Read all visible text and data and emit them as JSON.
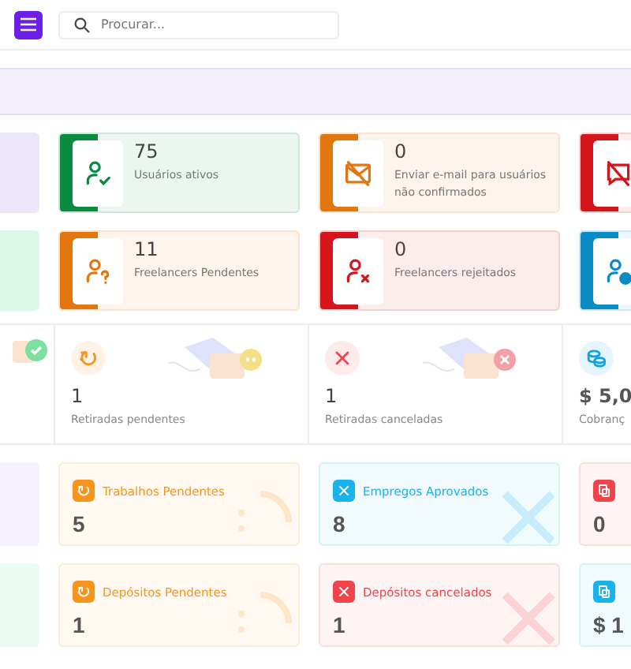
{
  "header": {
    "search": {
      "placeholder": "Procurar..."
    }
  },
  "stat_rows": [
    [
      {
        "color": "#ece6fb"
      },
      {
        "color": "#0b8a41",
        "kind": "user-check",
        "value": "75",
        "label": "Usuários ativos"
      },
      {
        "color": "#e2760f",
        "kind": "mail-off",
        "value": "0",
        "label": "Enviar e-mail para usuários não confirmados"
      },
      {
        "color": "#d4151b",
        "kind": "chat-off"
      }
    ],
    [
      {
        "color": "#dcf8e8"
      },
      {
        "color": "#e2760f",
        "kind": "user-question",
        "value": "11",
        "label": "Freelancers Pendentes"
      },
      {
        "color": "#d4151b",
        "kind": "user-x",
        "value": "0",
        "label": "Freelancers rejeitados"
      },
      {
        "color": "#0a8bc6",
        "kind": "user-badge"
      }
    ]
  ],
  "widgets": [
    {
      "kind": "check"
    },
    {
      "kind": "refresh",
      "value": "1",
      "label": "Retiradas pendentes"
    },
    {
      "kind": "x",
      "value": "1",
      "label": "Retiradas canceladas"
    },
    {
      "kind": "coins",
      "value": "$ 5,0",
      "label": "Cobranç"
    }
  ],
  "mini_rows": [
    [
      {
        "color": "#f5f1fe"
      },
      {
        "color": "#f7941d",
        "kind": "refresh",
        "title": "Trabalhos Pendentes",
        "value": "5"
      },
      {
        "color": "#17b3ea",
        "kind": "x",
        "title": "Empregos Aprovados",
        "value": "8"
      },
      {
        "color": "#f0434a",
        "kind": "doc",
        "value": "0"
      }
    ],
    [
      {
        "color": "#eafbf1"
      },
      {
        "color": "#f7941d",
        "kind": "refresh",
        "title": "Depósitos Pendentes",
        "value": "1"
      },
      {
        "color": "#f0434a",
        "kind": "x",
        "title": "Depósitos cancelados",
        "value": "1"
      },
      {
        "color": "#17b3ea",
        "kind": "doc",
        "value": "$ 1"
      }
    ]
  ]
}
